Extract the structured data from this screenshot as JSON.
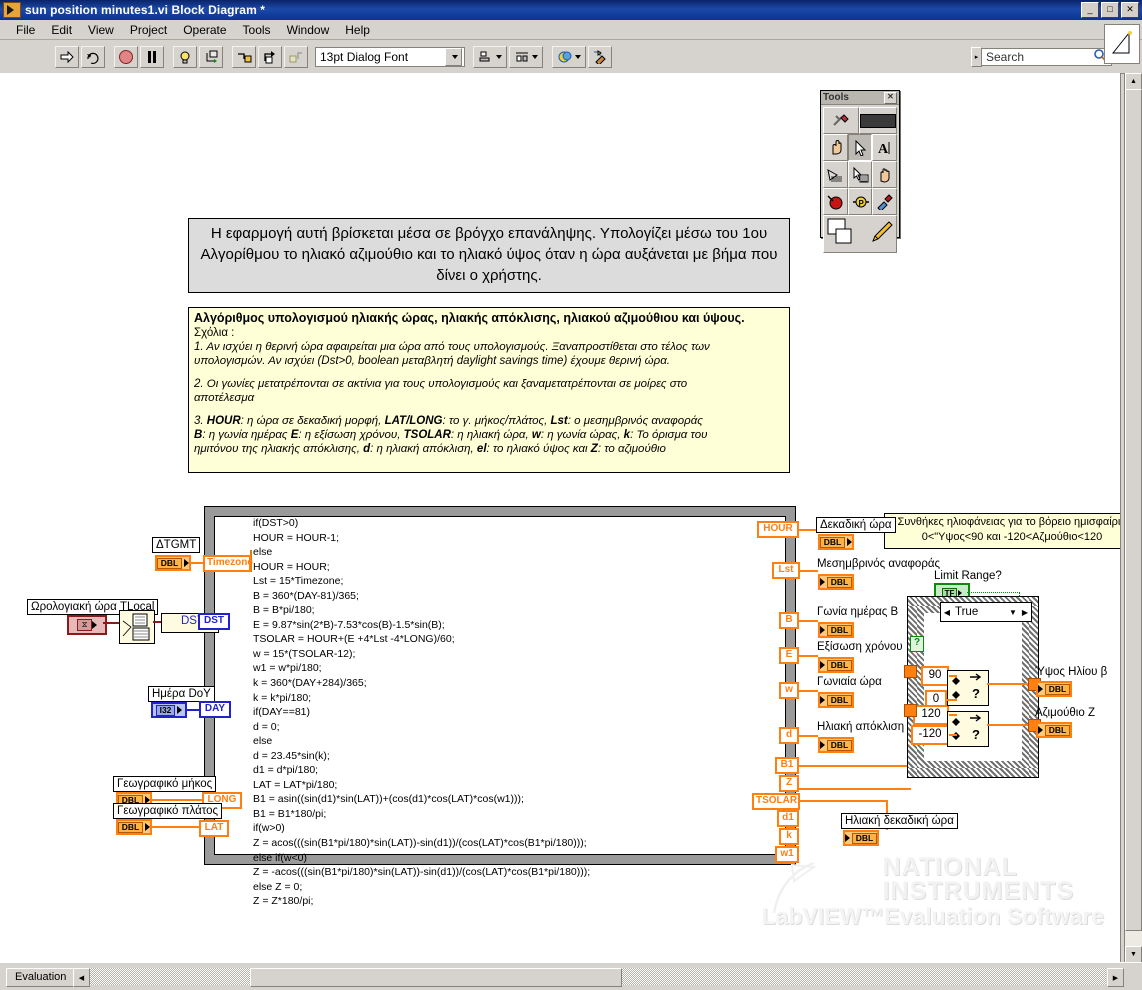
{
  "window": {
    "title": "sun position minutes1.vi Block Diagram *",
    "minimize": "_",
    "maximize": "□",
    "close": "✕"
  },
  "menu": {
    "items": [
      "File",
      "Edit",
      "View",
      "Project",
      "Operate",
      "Tools",
      "Window",
      "Help"
    ]
  },
  "toolbar": {
    "run_icon": "run-arrow",
    "run_continuous_icon": "run-continuously",
    "abort_icon": "abort-execution",
    "pause_icon": "pause",
    "highlight_icon": "highlight-execution",
    "step_into_icon": "step-into",
    "step_over_icon": "step-over",
    "step_out_icon": "step-out",
    "retain_icon": "retain-wire-values",
    "font": "13pt Dialog Font",
    "align_icon": "align-objects",
    "distribute_icon": "distribute-objects",
    "reorder_icon": "reorder",
    "cleanup_icon": "clean-up-diagram",
    "search_placeholder": "Search",
    "search_value": "",
    "search_icon": "magnifier-icon",
    "help_icon": "context-help-icon"
  },
  "tools_palette": {
    "title": "Tools",
    "close_label": "✕",
    "items": [
      {
        "name": "automatic-tool-selection",
        "glyph": "✖"
      },
      {
        "name": "automatic-indicator",
        "glyph": ""
      },
      {
        "name": "operate-value-tool",
        "glyph": "✋"
      },
      {
        "name": "position-size-select-tool",
        "glyph": "➤"
      },
      {
        "name": "edit-text-tool",
        "glyph": "A"
      },
      {
        "name": "connect-wire-tool",
        "glyph": "⌇"
      },
      {
        "name": "object-shortcut-menu-tool",
        "glyph": "▤"
      },
      {
        "name": "scroll-window-tool",
        "glyph": "✋"
      },
      {
        "name": "set-clear-breakpoint-tool",
        "glyph": "●"
      },
      {
        "name": "probe-data-tool",
        "glyph": "Ⓟ"
      },
      {
        "name": "get-color-tool",
        "glyph": "✒"
      },
      {
        "name": "color-swatches",
        "glyph": "▤"
      },
      {
        "name": "set-color-tool",
        "glyph": "🖌"
      }
    ]
  },
  "diagram": {
    "intro_note": "Η εφαρμογή αυτή βρίσκεται μέσα σε βρόγχο επανάληψης. Υπολογίζει μέσω του 1ου Αλγορίθμου το ηλιακό αζιμούθιο και το ηλιακό ύψος όταν η ώρα αυξάνεται με βήμα που δίνει ο χρήστης.",
    "algorithm_note": {
      "title": "Αλγόριθμος υπολογισμού ηλιακής ώρας, ηλιακής απόκλισης, ηλιακού αζιμούθιου και ύψους.",
      "subtitle": "Σχόλια :",
      "p1a": "1. Αν ισχύει η θερινή ώρα αφαιρείται μια ώρα από τους υπολογισμούς. Ξαναπροστίθεται στο τέλος των",
      "p1b": "υπολογισμών. Αν ισχύει (Dst>0, boolean μεταβλητή daylight savings time) έχουμε θερινή ώρα.",
      "p2a": "2. Οι γωνίες μετατρέπονται σε ακτίνια για τους υπολογισμούς και ξαναμετατρέπονται σε μοίρες στο",
      "p2b": "αποτέλεσμα",
      "p3a_pre": "3. ",
      "p3a_b1": "HOUR",
      "p3a_t1": ": η ώρα σε δεκαδική μορφή, ",
      "p3a_b2": "LAT/LONG",
      "p3a_t2": ": το γ. μήκος/πλάτος, ",
      "p3a_b3": "Lst",
      "p3a_t3": ": ο μεσημβρινός αναφοράς",
      "p3b_b1": "B",
      "p3b_t1": ": η γωνία ημέρας ",
      "p3b_b2": "E",
      "p3b_t2": ": η εξίσωση χρόνου, ",
      "p3b_b3": "TSOLAR",
      "p3b_t3": ": η ηλιακή ώρα, ",
      "p3b_b4": "w",
      "p3b_t4": ": η γωνία ώρας, ",
      "p3b_b5": "k",
      "p3b_t5": ": Το όρισμα του",
      "p3c_t1": "ημιτόνου της ηλιακής απόκλισης, ",
      "p3c_b1": "d",
      "p3c_t2": ": η ηλιακή απόκλιση,  ",
      "p3c_b2": "el",
      "p3c_t3": ": το ηλιακό ύψος και ",
      "p3c_b3": "Z",
      "p3c_t4": ": το αζιμούθιο"
    },
    "formula_code": "if(DST>0)\nHOUR = HOUR-1;\nelse\nHOUR = HOUR;\nLst = 15*Timezone;\nB = 360*(DAY-81)/365;\nB = B*pi/180;\nE = 9.87*sin(2*B)-7.53*cos(B)-1.5*sin(B);\nTSOLAR = HOUR+(E +4*Lst -4*LONG)/60;\nw = 15*(TSOLAR-12);\nw1 = w*pi/180;\nk = 360*(DAY+284)/365;\nk = k*pi/180;\nif(DAY==81)\nd = 0;\nelse\nd = 23.45*sin(k);\nd1 = d*pi/180;\nLAT = LAT*pi/180;\nB1 = asin((sin(d1)*sin(LAT))+(cos(d1)*cos(LAT)*cos(w1)));\nB1 = B1*180/pi;\nif(w>0)\nZ = acos(((sin(B1*pi/180)*sin(LAT))-sin(d1))/(cos(LAT)*cos(B1*pi/180)));\nelse if(w<0)\nZ = -acos(((sin(B1*pi/180)*sin(LAT))-sin(d1))/(cos(LAT)*cos(B1*pi/180)));\nelse Z = 0;\nZ = Z*180/pi;",
    "inputs": [
      {
        "label": "ΔTGMT",
        "type": "DBL",
        "tunnel": "Timezone"
      },
      {
        "label": "Ωρολογιακή ώρα TLocal",
        "type": "TIME",
        "tunnel": "DST",
        "wire_label": "DST"
      },
      {
        "label": "Ημέρα DoY",
        "type": "I32",
        "tunnel": "DAY"
      },
      {
        "label": "Γεωγραφικό μήκος",
        "type": "DBL",
        "tunnel": "LONG"
      },
      {
        "label": "Γεωγραφικό πλάτος",
        "type": "DBL",
        "tunnel": "LAT"
      }
    ],
    "outputs": [
      {
        "tunnel": "HOUR",
        "label": "Δεκαδική ώρα",
        "type": "DBL"
      },
      {
        "tunnel": "Lst",
        "label": "Μεσημβρινός αναφοράς",
        "type": "DBL"
      },
      {
        "tunnel": "B",
        "label": "Γωνία ημέρας Β",
        "type": "DBL"
      },
      {
        "tunnel": "E",
        "label": "Εξίσωση χρόνου",
        "type": "DBL"
      },
      {
        "tunnel": "w",
        "label": "Γωνιαία ώρα",
        "type": "DBL"
      },
      {
        "tunnel": "d",
        "label": "Ηλιακή απόκλιση",
        "type": "DBL"
      },
      {
        "tunnel": "B1",
        "label": "",
        "type": ""
      },
      {
        "tunnel": "Z",
        "label": "",
        "type": ""
      },
      {
        "tunnel": "TSOLAR",
        "label": "Ηλιακή δεκαδική ώρα",
        "type": "DBL"
      },
      {
        "tunnel": "d1",
        "label": "",
        "type": ""
      },
      {
        "tunnel": "k",
        "label": "",
        "type": ""
      },
      {
        "tunnel": "w1",
        "label": "",
        "type": ""
      }
    ],
    "hemisphere_note_line1": "Συνθήκες ηλιοφάνειας για το βόρειο ημισφαίριο",
    "hemisphere_note_line2": "0<\"Υψος<90 και -120<Αζμούθιο<120",
    "limit_range_label": "Limit Range?",
    "limit_range_value": "TF",
    "case_selector": "True",
    "case_question": "?",
    "constants": {
      "upper_elevation": "90",
      "lower_elevation": "0",
      "upper_azimuth": "120",
      "lower_azimuth": "-120"
    },
    "final_outputs": [
      {
        "label": "Ύψος Ηλίου β",
        "type": "DBL"
      },
      {
        "label": "Αζιμούθιο Ζ",
        "type": "DBL"
      }
    ]
  },
  "watermark": {
    "line1": "NATIONAL",
    "line2": "INSTRUMENTS",
    "line3": "LabVIEW™Evaluation Software"
  },
  "statusbar": {
    "evaluation": "Evaluation",
    "left_arrow": "◀",
    "right_arrow": "▶"
  },
  "colors": {
    "accent_orange": "#ff7f11",
    "wire_blue": "#2222cc",
    "green": "#0a8a0a",
    "title_blue": "#0a246a"
  }
}
